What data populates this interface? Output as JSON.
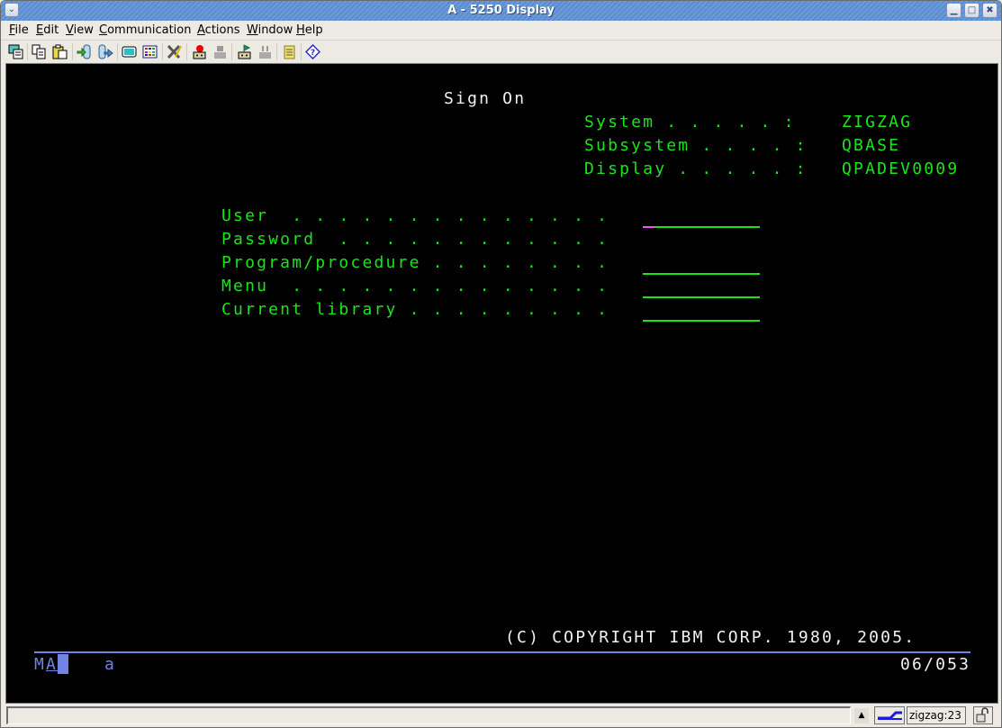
{
  "window": {
    "title": "A - 5250 Display",
    "controls": [
      "minimize",
      "maximize",
      "close"
    ]
  },
  "menubar": {
    "items": [
      {
        "label": "File",
        "accel": "F",
        "rest": "ile"
      },
      {
        "label": "Edit",
        "accel": "E",
        "rest": "dit"
      },
      {
        "label": "View",
        "accel": "V",
        "rest": "iew"
      },
      {
        "label": "Communication",
        "accel": "C",
        "rest": "ommunication"
      },
      {
        "label": "Actions",
        "accel": "A",
        "rest": "ctions"
      },
      {
        "label": "Window",
        "accel": "W",
        "rest": "indow"
      },
      {
        "label": "Help",
        "accel": "H",
        "rest": "elp"
      }
    ]
  },
  "toolbar": {
    "icons": [
      "print-screen-icon",
      "copy-icon",
      "paste-icon",
      "send-file-icon",
      "receive-file-icon",
      "display-icon",
      "keypad-icon",
      "macro-edit-icon",
      "record-macro-icon",
      "stop-macro-icon",
      "play-macro-icon",
      "pause-macro-icon",
      "notes-icon",
      "help-icon"
    ]
  },
  "screen": {
    "title": "Sign On",
    "info": [
      {
        "label": "System . . . . . :",
        "value": "ZIGZAG"
      },
      {
        "label": "Subsystem . . . . :",
        "value": "QBASE"
      },
      {
        "label": "Display . . . . . :",
        "value": "QPADEV0009"
      }
    ],
    "fields": [
      {
        "label": "User  . . . . . . . . . . . . . .",
        "value": "",
        "name": "user"
      },
      {
        "label": "Password  . . . . . . . . . . . .",
        "value": "",
        "name": "password"
      },
      {
        "label": "Program/procedure . . . . . . . .",
        "value": "",
        "name": "program-procedure"
      },
      {
        "label": "Menu  . . . . . . . . . . . . . .",
        "value": "",
        "name": "menu"
      },
      {
        "label": "Current library . . . . . . . . .",
        "value": "",
        "name": "current-library"
      }
    ],
    "copyright": "(C) COPYRIGHT IBM CORP. 1980, 2005."
  },
  "oia": {
    "mode_m": "M",
    "mode_a": "A",
    "shift_indicator": "a",
    "cursor_position": "06/053"
  },
  "statusbar": {
    "message": "",
    "host": "zigzag:23"
  }
}
